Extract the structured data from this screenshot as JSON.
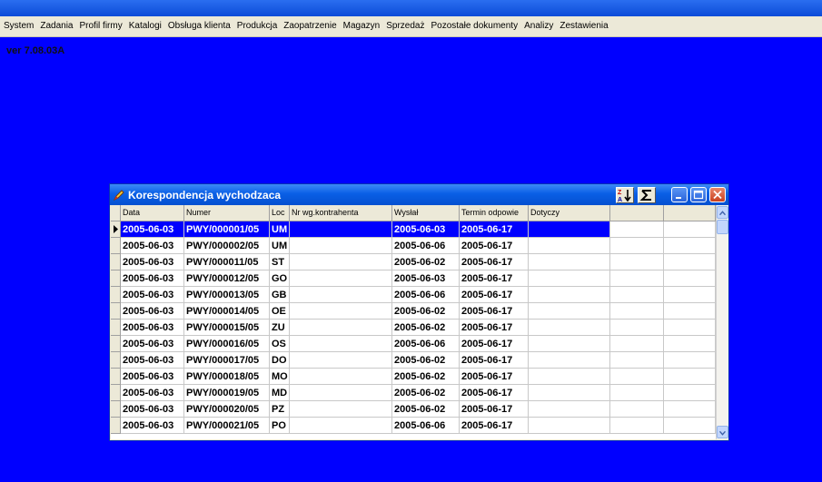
{
  "menu": [
    "System",
    "Zadania",
    "Profil firmy",
    "Katalogi",
    "Obsługa klienta",
    "Produkcja",
    "Zaopatrzenie",
    "Magazyn",
    "Sprzedaż",
    "Pozostałe dokumenty",
    "Analizy",
    "Zestawienia"
  ],
  "version": "ver 7.08.03A",
  "window": {
    "title": "Korespondencja wychodzaca",
    "sort_icon": "sort-az-icon",
    "sum_icon": "sigma-icon"
  },
  "columns": [
    "Data",
    "Numer",
    "Loc",
    "Nr wg.kontrahenta",
    "Wysłał",
    "Termin odpowie",
    "Dotyczy",
    "",
    ""
  ],
  "rows": [
    {
      "data": "2005-06-03",
      "numer": "PWY/000001/05",
      "loc": "UM",
      "nr": "",
      "wyslal": "2005-06-03",
      "termin": "2005-06-17",
      "dotyczy": ""
    },
    {
      "data": "2005-06-03",
      "numer": "PWY/000002/05",
      "loc": "UM",
      "nr": "",
      "wyslal": "2005-06-06",
      "termin": "2005-06-17",
      "dotyczy": ""
    },
    {
      "data": "2005-06-03",
      "numer": "PWY/000011/05",
      "loc": "ST",
      "nr": "",
      "wyslal": "2005-06-02",
      "termin": "2005-06-17",
      "dotyczy": ""
    },
    {
      "data": "2005-06-03",
      "numer": "PWY/000012/05",
      "loc": "GO",
      "nr": "",
      "wyslal": "2005-06-03",
      "termin": "2005-06-17",
      "dotyczy": ""
    },
    {
      "data": "2005-06-03",
      "numer": "PWY/000013/05",
      "loc": "GB",
      "nr": "",
      "wyslal": "2005-06-06",
      "termin": "2005-06-17",
      "dotyczy": ""
    },
    {
      "data": "2005-06-03",
      "numer": "PWY/000014/05",
      "loc": "OE",
      "nr": "",
      "wyslal": "2005-06-02",
      "termin": "2005-06-17",
      "dotyczy": ""
    },
    {
      "data": "2005-06-03",
      "numer": "PWY/000015/05",
      "loc": "ZU",
      "nr": "",
      "wyslal": "2005-06-02",
      "termin": "2005-06-17",
      "dotyczy": ""
    },
    {
      "data": "2005-06-03",
      "numer": "PWY/000016/05",
      "loc": "OS",
      "nr": "",
      "wyslal": "2005-06-06",
      "termin": "2005-06-17",
      "dotyczy": ""
    },
    {
      "data": "2005-06-03",
      "numer": "PWY/000017/05",
      "loc": "DO",
      "nr": "",
      "wyslal": "2005-06-02",
      "termin": "2005-06-17",
      "dotyczy": ""
    },
    {
      "data": "2005-06-03",
      "numer": "PWY/000018/05",
      "loc": "MO",
      "nr": "",
      "wyslal": "2005-06-02",
      "termin": "2005-06-17",
      "dotyczy": ""
    },
    {
      "data": "2005-06-03",
      "numer": "PWY/000019/05",
      "loc": "MD",
      "nr": "",
      "wyslal": "2005-06-02",
      "termin": "2005-06-17",
      "dotyczy": ""
    },
    {
      "data": "2005-06-03",
      "numer": "PWY/000020/05",
      "loc": "PZ",
      "nr": "",
      "wyslal": "2005-06-02",
      "termin": "2005-06-17",
      "dotyczy": ""
    },
    {
      "data": "2005-06-03",
      "numer": "PWY/000021/05",
      "loc": "PO",
      "nr": "",
      "wyslal": "2005-06-06",
      "termin": "2005-06-17",
      "dotyczy": ""
    }
  ],
  "colors": {
    "desktop": "#0000ff",
    "selection": "#0000ff",
    "titlebar": "#0a5fe6",
    "chrome": "#ece9d8"
  }
}
